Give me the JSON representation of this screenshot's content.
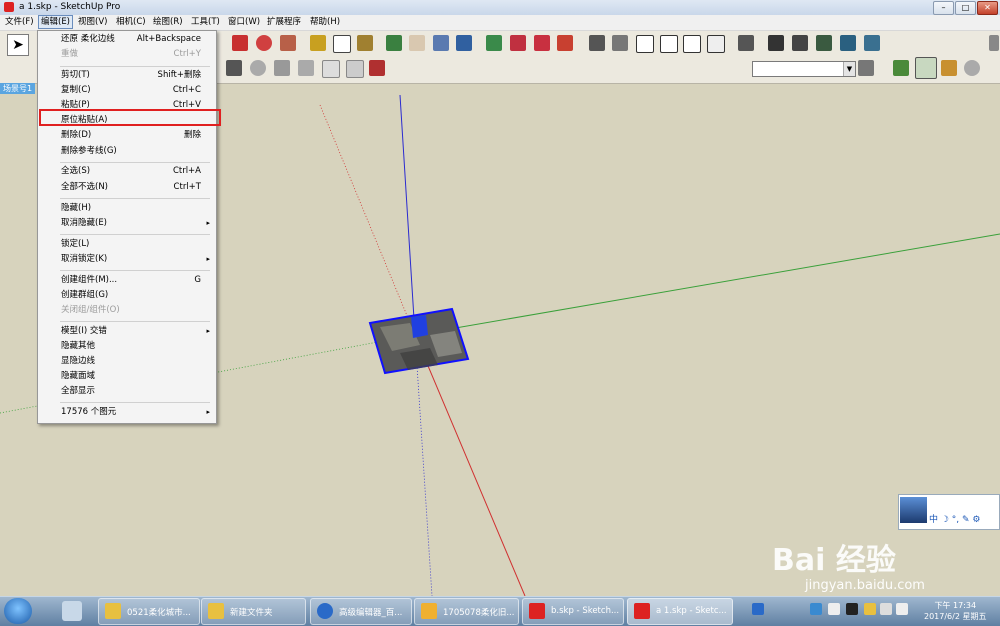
{
  "window": {
    "title": "a 1.skp - SketchUp Pro",
    "min": "–",
    "max": "□",
    "close": "✕"
  },
  "menubar": [
    "文件(F)",
    "编辑(E)",
    "视图(V)",
    "相机(C)",
    "绘图(R)",
    "工具(T)",
    "窗口(W)",
    "扩展程序",
    "帮助(H)"
  ],
  "scene_tab": "场景号1",
  "edit_menu": {
    "items": [
      {
        "label": "还原 柔化边线",
        "shortcut": "Alt+Backspace"
      },
      {
        "label": "重做",
        "shortcut": "Ctrl+Y"
      },
      {
        "label": "剪切(T)",
        "shortcut": "Shift+删除"
      },
      {
        "label": "复制(C)",
        "shortcut": "Ctrl+C"
      },
      {
        "label": "粘贴(P)",
        "shortcut": "Ctrl+V"
      },
      {
        "label": "原位粘贴(A)",
        "shortcut": ""
      },
      {
        "label": "删除(D)",
        "shortcut": "删除"
      },
      {
        "label": "删除参考线(G)",
        "shortcut": ""
      },
      {
        "label": "全选(S)",
        "shortcut": "Ctrl+A"
      },
      {
        "label": "全部不选(N)",
        "shortcut": "Ctrl+T"
      },
      {
        "label": "隐藏(H)",
        "shortcut": ""
      },
      {
        "label": "取消隐藏(E)",
        "shortcut": ""
      },
      {
        "label": "锁定(L)",
        "shortcut": ""
      },
      {
        "label": "取消锁定(K)",
        "shortcut": ""
      },
      {
        "label": "创建组件(M)...",
        "shortcut": "G"
      },
      {
        "label": "创建群组(G)",
        "shortcut": ""
      },
      {
        "label": "关闭组/组件(O)",
        "shortcut": ""
      },
      {
        "label": "模型(I) 交错",
        "shortcut": ""
      },
      {
        "label": "隐藏其他",
        "shortcut": ""
      },
      {
        "label": "显隐边线",
        "shortcut": ""
      },
      {
        "label": "隐藏面域",
        "shortcut": ""
      },
      {
        "label": "全部显示",
        "shortcut": ""
      },
      {
        "label": "17576 个图元",
        "shortcut": ""
      }
    ],
    "submenu_arrow": "▸"
  },
  "ime": {
    "text": "中 ☽ °, ✎ ⚙"
  },
  "watermark": {
    "brand": "Bai 经验",
    "url": "jingyan.baidu.com"
  },
  "taskbar": {
    "buttons": [
      "0521柔化城市...",
      "新建文件夹",
      "高级编辑器_百...",
      "1705078柔化旧...",
      "b.skp - Sketch...",
      "a 1.skp - Sketc..."
    ],
    "clock_time": "下午 17:34",
    "clock_date": "2017/6/2 星期五"
  },
  "colors": {
    "viewport_bg": "#d7d3bd",
    "highlight": "#e02020",
    "axis_red": "#d03030",
    "axis_green": "#3aa03a",
    "axis_blue": "#2a2ad0"
  }
}
